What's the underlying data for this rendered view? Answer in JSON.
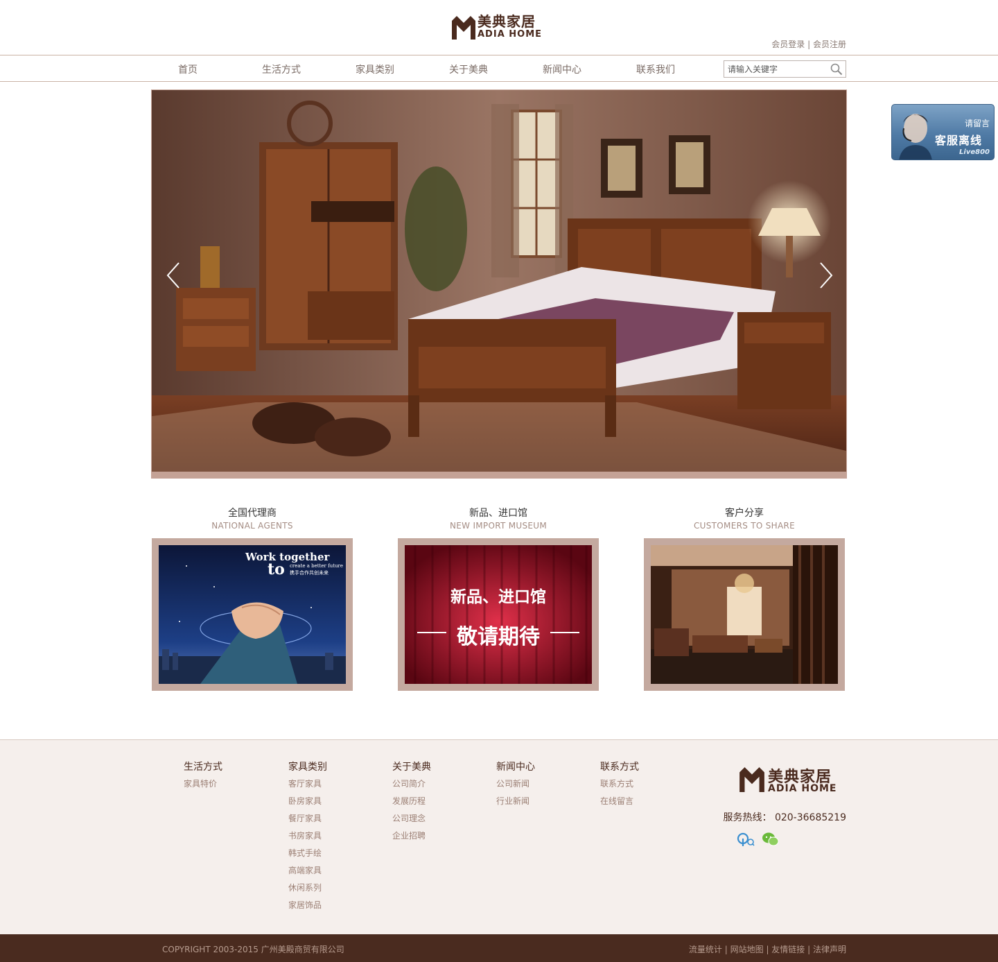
{
  "header": {
    "logo_cn": "美典家居",
    "logo_en": "ADIA HOME",
    "member_login": "会员登录",
    "member_sep": " | ",
    "member_register": "会员注册"
  },
  "nav": {
    "items": [
      "首页",
      "生活方式",
      "家具类别",
      "关于美典",
      "新闻中心",
      "联系我们"
    ],
    "search_placeholder": "请输入关键字"
  },
  "widget": {
    "leave_message": "请留言",
    "status": "客服离线",
    "brand": "Live800"
  },
  "features": [
    {
      "title": "全国代理商",
      "subtitle": "NATIONAL AGENTS",
      "image_text_1": "Work together",
      "image_text_2": "to",
      "image_text_3": "create a better future",
      "image_text_4": "携手合作共创未来"
    },
    {
      "title": "新品、进口馆",
      "subtitle": "NEW IMPORT MUSEUM",
      "image_text_1": "新品、进口馆",
      "image_text_2": "敬请期待"
    },
    {
      "title": "客户分享",
      "subtitle": "CUSTOMERS TO SHARE"
    }
  ],
  "footer": {
    "columns": [
      {
        "head": "生活方式",
        "links": [
          "家具特价"
        ]
      },
      {
        "head": "家具类别",
        "links": [
          "客厅家具",
          "卧房家具",
          "餐厅家具",
          "书房家具",
          "韩式手绘",
          "高端家具",
          "休闲系列",
          "家居饰品"
        ]
      },
      {
        "head": "关于美典",
        "links": [
          "公司简介",
          "发展历程",
          "公司理念",
          "企业招聘"
        ]
      },
      {
        "head": "新闻中心",
        "links": [
          "公司新闻",
          "行业新闻"
        ]
      },
      {
        "head": "联系方式",
        "links": [
          "联系方式",
          "在线留言"
        ]
      }
    ],
    "logo_cn": "美典家居",
    "logo_en": "ADIA HOME",
    "hotline": "服务热线：  020-36685219",
    "social_icons": [
      "qq-icon",
      "wechat-icon"
    ]
  },
  "bottom": {
    "copyright": "COPYRIGHT 2003-2015 广州美殿商贸有限公司",
    "links": [
      "流量统计",
      "网站地图",
      "友情链接",
      "法律声明"
    ],
    "separator": " | "
  },
  "colors": {
    "brand_brown": "#4a2a1e",
    "frame_tan": "#c4a99f",
    "footer_bg": "#f5efec",
    "bottom_bar": "#4a2b1f"
  }
}
